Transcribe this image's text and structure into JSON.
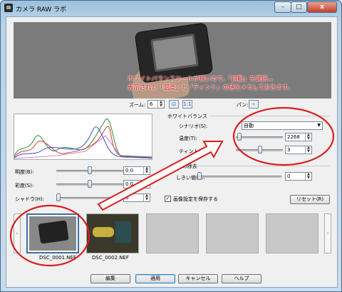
{
  "window": {
    "title": "カメラ RAW ラボ",
    "min_glyph": "–",
    "max_glyph": "□",
    "close_glyph": "x"
  },
  "annotation": {
    "line1": "ホワイトバランスツールが無いので、「自動」を選択。。",
    "line2": "表示された「温度」と「ティント」の値をメモしておきます。"
  },
  "zoom": {
    "label": "ズーム:",
    "value": "6",
    "fit_icon": "fit-window-icon",
    "actual_icon": "actual-size-icon",
    "actual_text": "1:1"
  },
  "pan": {
    "label": "パン:",
    "icon": "pan-icon",
    "glyph": "+"
  },
  "white_balance": {
    "group_label": "ホワイトバランス",
    "scenario_label": "シナリオ(S):",
    "scenario_value": "自動",
    "temperature_label": "温度(T):",
    "temperature_value": "2268",
    "temperature_pos": 0.03,
    "tint_label": "ティント(I):",
    "tint_value": "3",
    "tint_pos": 0.52
  },
  "noise": {
    "group_label": "ノイズの除去",
    "threshold_label": "しきい値(R):",
    "threshold_value": "0",
    "threshold_pos": 0.0
  },
  "adjust": {
    "brightness_label": "明度(B):",
    "brightness_value": "0.0",
    "brightness_pos": 0.5,
    "saturation_label": "彩度(S):",
    "saturation_value": "0.0",
    "saturation_pos": 0.5,
    "shadow_label": "シャドウ(H):",
    "shadow_value": "0",
    "shadow_pos": 0.0
  },
  "save_settings": {
    "label": "画像設定を保存する",
    "checked_glyph": "✓"
  },
  "reset_label": "リセット(R)",
  "thumbnails": [
    {
      "name": "DSC_0001.NEF"
    },
    {
      "name": "DSC_0002.NEF"
    }
  ],
  "nav": {
    "left": "‹",
    "right": "›"
  },
  "buttons": {
    "edit": "編集",
    "apply": "適用",
    "cancel": "キャンセル",
    "help": "ヘルプ"
  },
  "spin_glyphs": {
    "up": "▲",
    "down": "▼"
  },
  "colors": {
    "annotation_red": "#e21b1b",
    "circle_red": "#d91f1f"
  }
}
